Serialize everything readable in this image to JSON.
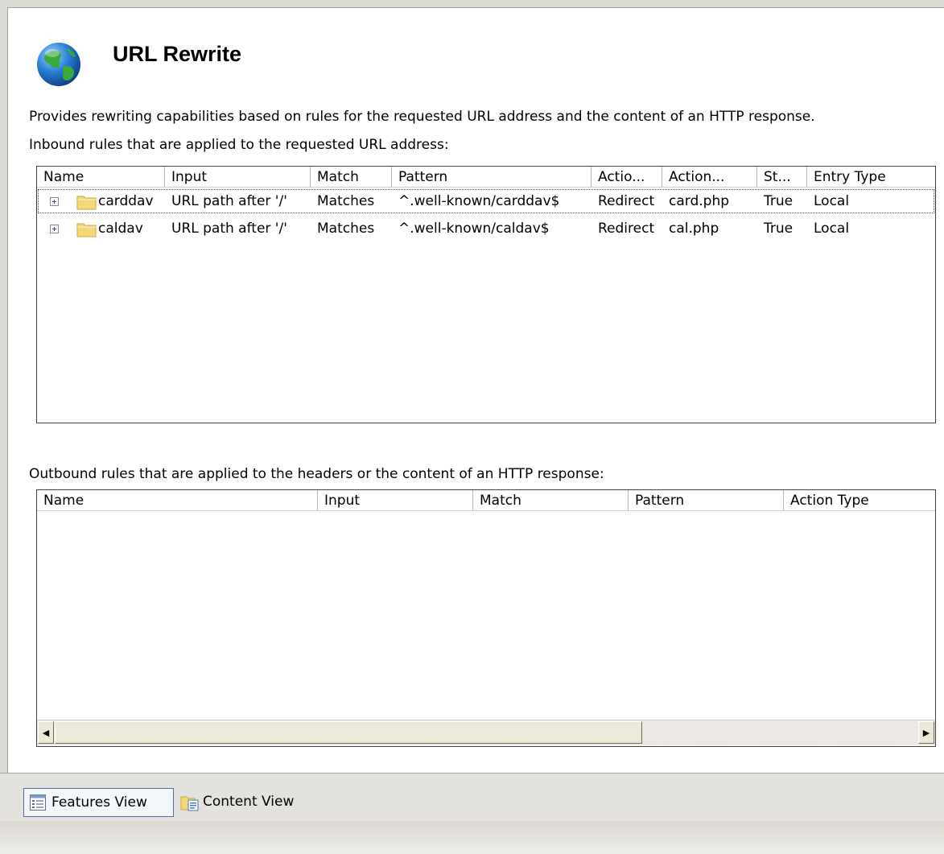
{
  "feature": {
    "title": "URL Rewrite",
    "icon": "globe-icon",
    "description": "Provides rewriting capabilities based on rules for the requested URL address and the content of an HTTP response."
  },
  "inbound": {
    "label": "Inbound rules that are applied to the requested URL address:",
    "columns": [
      "Name",
      "Input",
      "Match",
      "Pattern",
      "Actio...",
      "Action...",
      "St...",
      "Entry Type"
    ],
    "rows": [
      {
        "name": "carddav",
        "input": "URL path after '/'",
        "match": "Matches",
        "pattern": "^.well-known/carddav$",
        "action_type": "Redirect",
        "action_url": "card.php",
        "status": "True",
        "entry_type": "Local"
      },
      {
        "name": "caldav",
        "input": "URL path after '/'",
        "match": "Matches",
        "pattern": "^.well-known/caldav$",
        "action_type": "Redirect",
        "action_url": "cal.php",
        "status": "True",
        "entry_type": "Local"
      }
    ]
  },
  "outbound": {
    "label": "Outbound rules that are applied to the headers or the content of an HTTP response:",
    "columns": [
      "Name",
      "Input",
      "Match",
      "Pattern",
      "Action Type"
    ]
  },
  "views": {
    "features_label": "Features View",
    "content_label": "Content View"
  },
  "colors": {
    "folder": "#f5d77a",
    "selection_border": "#506fa0",
    "globe_ocean": "#2a7fd4",
    "globe_land": "#3aa83a"
  }
}
